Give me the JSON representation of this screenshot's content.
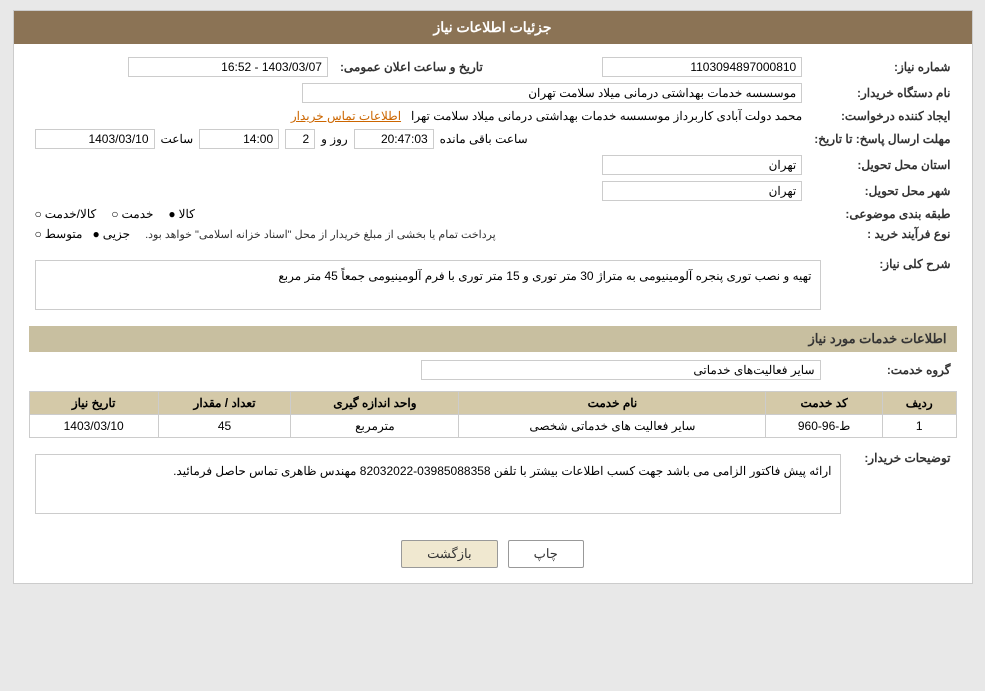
{
  "header": {
    "title": "جزئیات اطلاعات نیاز"
  },
  "fields": {
    "need_number_label": "شماره نیاز:",
    "need_number_value": "1103094897000810",
    "buyer_org_label": "نام دستگاه خریدار:",
    "buyer_org_value": "موسسسه خدمات بهداشتی درمانی میلاد سلامت تهران",
    "creator_label": "ایجاد کننده درخواست:",
    "creator_name": "محمد دولت آبادی کاربرداز موسسسه خدمات بهداشتی درمانی میلاد سلامت تهرا",
    "creator_contact": "اطلاعات تماس خریدار",
    "deadline_label": "مهلت ارسال پاسخ: تا تاریخ:",
    "deadline_date": "1403/03/10",
    "deadline_time": "14:00",
    "deadline_days": "2",
    "deadline_remaining": "20:47:03",
    "announce_label": "تاریخ و ساعت اعلان عمومی:",
    "announce_value": "1403/03/07 - 16:52",
    "province_label": "استان محل تحویل:",
    "province_value": "تهران",
    "city_label": "شهر محل تحویل:",
    "city_value": "تهران",
    "category_label": "طبقه بندی موضوعی:",
    "category_kala": "کالا",
    "category_khedmat": "خدمت",
    "category_kala_khedmat": "کالا/خدمت",
    "process_label": "نوع فرآیند خرید :",
    "process_jozi": "جزیی",
    "process_motavasset": "متوسط",
    "process_note": "پرداخت تمام یا بخشی از مبلغ خریدار از محل \"اسناد خزانه اسلامی\" خواهد بود.",
    "description_label": "شرح کلی نیاز:",
    "description_value": "تهیه و نصب توری پنجره آلومینیومی به متراژ 30 متر توری و 15 متر توری با فرم آلومینیومی جمعاً 45 متر مربع",
    "services_section_label": "اطلاعات خدمات مورد نیاز",
    "service_group_label": "گروه خدمت:",
    "service_group_value": "سایر فعالیت‌های خدماتی",
    "table_headers": [
      "ردیف",
      "کد خدمت",
      "نام خدمت",
      "واحد اندازه گیری",
      "تعداد / مقدار",
      "تاریخ نیاز"
    ],
    "table_rows": [
      {
        "row": "1",
        "code": "ط-96-960",
        "name": "سایر فعالیت هاى خدماتی شخصی",
        "unit": "مترمربع",
        "quantity": "45",
        "date": "1403/03/10"
      }
    ],
    "buyer_notes_label": "توضیحات خریدار:",
    "buyer_notes_value": "ارائه پیش فاکتور الزامی می باشد جهت کسب اطلاعات بیشتر با تلفن 03985088358-82032022 مهندس ظاهری تماس حاصل فرمائید.",
    "days_label": "روز و",
    "hours_label": "ساعت باقی مانده"
  },
  "buttons": {
    "print_label": "چاپ",
    "back_label": "بازگشت"
  },
  "icons": {
    "radio_selected": "●",
    "radio_empty": "○"
  }
}
